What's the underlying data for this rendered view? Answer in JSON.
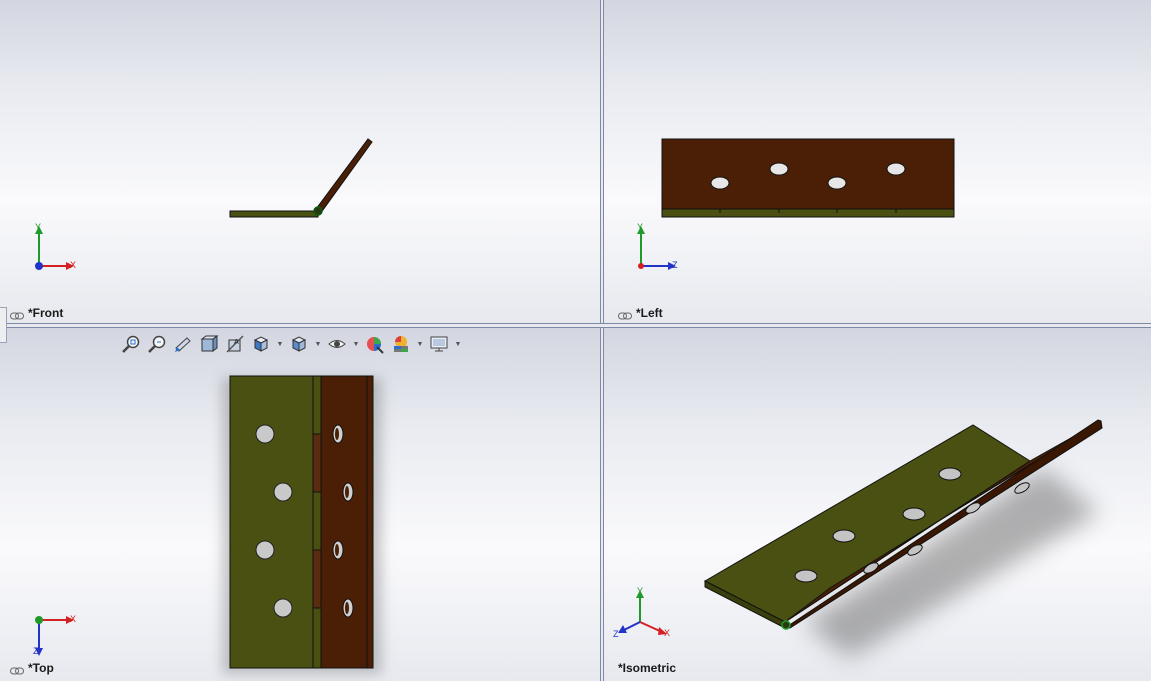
{
  "viewports": {
    "front": {
      "label": "*Front",
      "triad": {
        "vertical": "Y",
        "horizontal": "X"
      }
    },
    "left": {
      "label": "*Left",
      "triad": {
        "vertical": "Y",
        "horizontal": "Z"
      }
    },
    "top": {
      "label": "*Top",
      "triad": {
        "vertical": "Z",
        "horizontal": "X"
      }
    },
    "isometric": {
      "label": "*Isometric",
      "triad": {
        "vertical": "Y",
        "left": "Z",
        "right": "X"
      }
    }
  },
  "heads_up_toolbar": {
    "buttons": [
      "zoom-to-fit-icon",
      "zoom-to-area-icon",
      "previous-view-icon",
      "section-view-icon",
      "dynamic-annotation-views-icon",
      "view-orientation-icon",
      "display-style-icon",
      "hide-show-items-icon",
      "edit-appearance-icon",
      "apply-scene-icon",
      "view-settings-icon"
    ]
  },
  "colors": {
    "leaf_olive": "#4a4f12",
    "leaf_brown": "#4a1f05",
    "axis_x": "#d42020",
    "axis_y": "#1f9a2a",
    "axis_z": "#2233c8",
    "background_top": "#d3d6e0",
    "background_bottom": "#fafafc"
  }
}
